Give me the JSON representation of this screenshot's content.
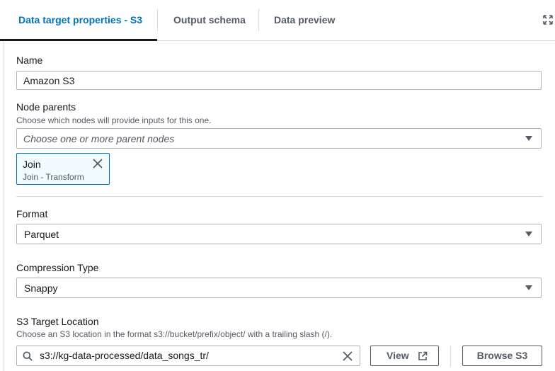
{
  "tabs": [
    {
      "label": "Data target properties - S3",
      "active": true
    },
    {
      "label": "Output schema",
      "active": false
    },
    {
      "label": "Data preview",
      "active": false
    }
  ],
  "name": {
    "label": "Name",
    "value": "Amazon S3"
  },
  "node_parents": {
    "label": "Node parents",
    "description": "Choose which nodes will provide inputs for this one.",
    "placeholder": "Choose one or more parent nodes",
    "tokens": [
      {
        "title": "Join",
        "subtitle": "Join - Transform"
      }
    ]
  },
  "format": {
    "label": "Format",
    "value": "Parquet"
  },
  "compression": {
    "label": "Compression Type",
    "value": "Snappy"
  },
  "s3_location": {
    "label": "S3 Target Location",
    "description": "Choose an S3 location in the format s3://bucket/prefix/object/ with a trailing slash (/).",
    "value": "s3://kg-data-processed/data_songs_tr/",
    "view_label": "View",
    "browse_label": "Browse S3"
  },
  "colors": {
    "accent": "#0073bb",
    "text": "#16191f",
    "secondary_text": "#545b64",
    "border": "#aab7b8"
  },
  "icons": [
    "expand-icon",
    "close-icon",
    "caret-down-icon",
    "search-icon",
    "clear-icon",
    "external-link-icon"
  ]
}
